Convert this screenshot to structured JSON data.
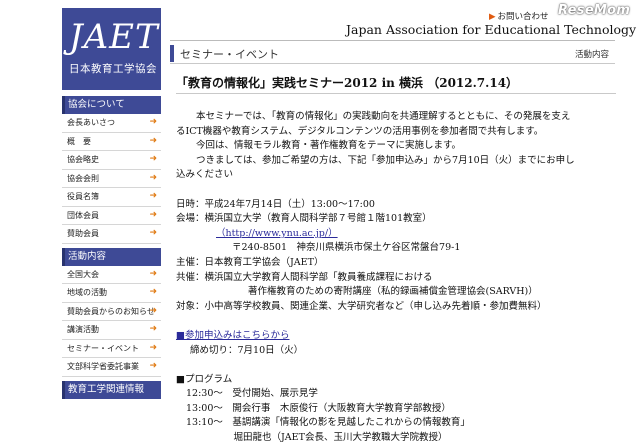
{
  "header": {
    "logo_big": "JAET",
    "logo_sub": "日本教育工学協会",
    "contact_label": "お問い合わせ",
    "watermark": "ReseMom",
    "assoc_name": "Japan Association for Educational Technology"
  },
  "section": {
    "title": "セミナー・イベント",
    "breadcrumb": "活動内容"
  },
  "sidebar": {
    "group1": {
      "title": "協会について",
      "items": [
        "会長あいさつ",
        "概　要",
        "協会略史",
        "協会会則",
        "役員名簿",
        "団体会員",
        "賛助会員"
      ]
    },
    "group2": {
      "title": "活動内容",
      "items": [
        "全国大会",
        "地域の活動",
        "賛助会員からのお知らせ",
        "講演活動",
        "セミナー・イベント",
        "文部科学省委託事業"
      ]
    },
    "group3": {
      "title": "教育工学関連情報"
    }
  },
  "article": {
    "headline": "「教育の情報化」実践セミナー2012 in 横浜",
    "headline_date": "（2012.7.14）",
    "para1_a": "本セミナーでは、「教育の情報化」の実践動向を共通理解するとともに、その発展を支え",
    "para1_b": "るICT機器や教育システム、デジタルコンテンツの活用事例を参加者間で共有します。",
    "para2": "今回は、情報モラル教育・著作権教育をテーマに実施します。",
    "para3_a": "つきましては、参加ご希望の方は、下記「参加申込み」から7月10日（火）までにお申し",
    "para3_b": "込みください",
    "date_line": "日時：平成24年7月14日（土）13:00～17:00",
    "venue_line": "会場：横浜国立大学（教育人間科学部７号館１階101教室）",
    "venue_url": "（http://www.ynu.ac.jp/）",
    "venue_addr": "〒240-8501　神奈川県横浜市保土ケ谷区常盤台79-1",
    "host_line": "主催：日本教育工学協会（JAET）",
    "cohost_line": "共催：横浜国立大学教育人間科学部「教員養成課程における",
    "cohost_line2": "著作権教育のための寄附講座（私的録画補償金管理協会(SARVH)）",
    "target_line": "対象：小中高等学校教員、関連企業、大学研究者など（申し込み先着順・参加費無料）",
    "apply_link": "■参加申込みはこちらから",
    "deadline": "締め切り：7月10日（火）",
    "program_title": "■プログラム",
    "program": [
      "12:30～　受付開始、展示見学",
      "13:00～　開会行事　木原俊行（大阪教育大学教育学部教授）",
      "13:10～　基調講演「情報化の影を見越したこれからの情報教育」",
      "　　　　　堀田龍也（JAET会長、玉川大学教職大学院教授）"
    ]
  }
}
